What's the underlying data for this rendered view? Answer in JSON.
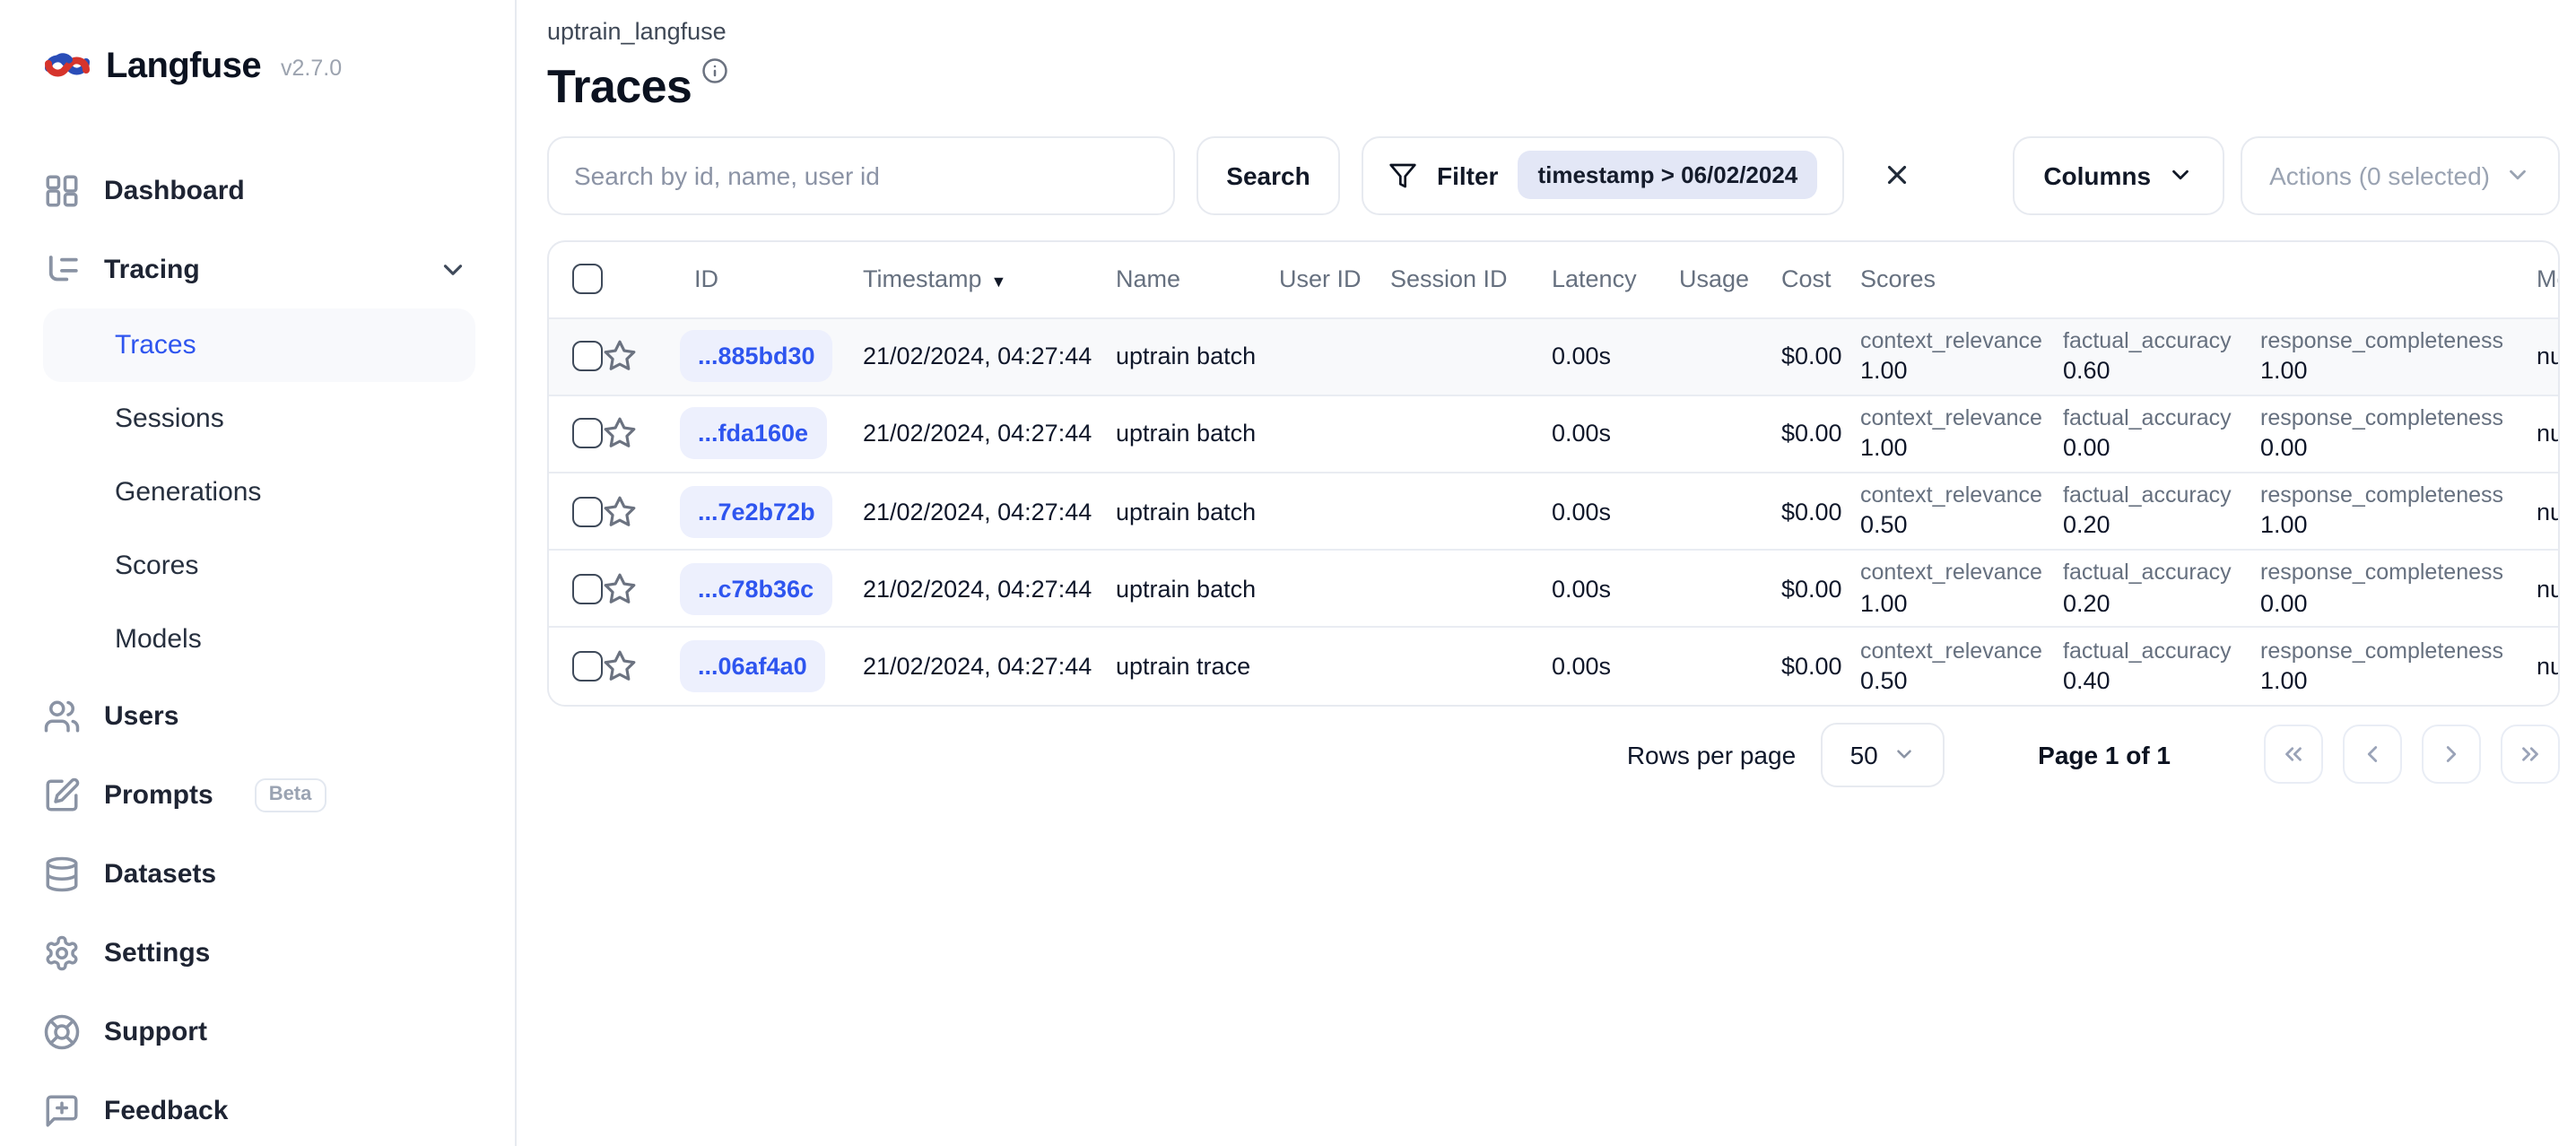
{
  "app": {
    "name": "Langfuse",
    "version": "v2.7.0"
  },
  "colors": {
    "accent_blue": "#2e55ef",
    "id_chip_bg": "#edf0fd",
    "filter_chip_bg": "#e3e7f6",
    "active_item_bg": "#f8f9fc"
  },
  "sidebar": {
    "dashboard": "Dashboard",
    "tracing": "Tracing",
    "tracing_children": {
      "traces": "Traces",
      "sessions": "Sessions",
      "generations": "Generations",
      "scores": "Scores",
      "models": "Models"
    },
    "users": "Users",
    "prompts": "Prompts",
    "prompts_badge": "Beta",
    "datasets": "Datasets",
    "settings": "Settings",
    "support": "Support",
    "feedback": "Feedback"
  },
  "header": {
    "project": "uptrain_langfuse",
    "title": "Traces"
  },
  "toolbar": {
    "search_placeholder": "Search by id, name, user id",
    "search_button": "Search",
    "filter_button": "Filter",
    "filter_chip": "timestamp > 06/02/2024",
    "columns_button": "Columns",
    "actions_button": "Actions (0 selected)"
  },
  "table": {
    "columns": {
      "id": "ID",
      "timestamp": "Timestamp",
      "sort_indicator": "▼",
      "name": "Name",
      "user_id": "User ID",
      "session_id": "Session ID",
      "latency": "Latency",
      "usage": "Usage",
      "cost": "Cost",
      "scores": "Scores",
      "metadata": "Metadata"
    },
    "rows": [
      {
        "id": "...885bd30",
        "timestamp": "21/02/2024, 04:27:44",
        "name": "uptrain batch",
        "latency": "0.00s",
        "cost": "$0.00",
        "metadata": "null",
        "scores": [
          {
            "label": "context_relevance",
            "value": "1.00"
          },
          {
            "label": "factual_accuracy",
            "value": "0.60"
          },
          {
            "label": "response_completeness",
            "value": "1.00"
          }
        ]
      },
      {
        "id": "...fda160e",
        "timestamp": "21/02/2024, 04:27:44",
        "name": "uptrain batch",
        "latency": "0.00s",
        "cost": "$0.00",
        "metadata": "null",
        "scores": [
          {
            "label": "context_relevance",
            "value": "1.00"
          },
          {
            "label": "factual_accuracy",
            "value": "0.00"
          },
          {
            "label": "response_completeness",
            "value": "0.00"
          }
        ]
      },
      {
        "id": "...7e2b72b",
        "timestamp": "21/02/2024, 04:27:44",
        "name": "uptrain batch",
        "latency": "0.00s",
        "cost": "$0.00",
        "metadata": "null",
        "scores": [
          {
            "label": "context_relevance",
            "value": "0.50"
          },
          {
            "label": "factual_accuracy",
            "value": "0.20"
          },
          {
            "label": "response_completeness",
            "value": "1.00"
          }
        ]
      },
      {
        "id": "...c78b36c",
        "timestamp": "21/02/2024, 04:27:44",
        "name": "uptrain batch",
        "latency": "0.00s",
        "cost": "$0.00",
        "metadata": "null",
        "scores": [
          {
            "label": "context_relevance",
            "value": "1.00"
          },
          {
            "label": "factual_accuracy",
            "value": "0.20"
          },
          {
            "label": "response_completeness",
            "value": "0.00"
          }
        ]
      },
      {
        "id": "...06af4a0",
        "timestamp": "21/02/2024, 04:27:44",
        "name": "uptrain trace",
        "latency": "0.00s",
        "cost": "$0.00",
        "metadata": "null",
        "scores": [
          {
            "label": "context_relevance",
            "value": "0.50"
          },
          {
            "label": "factual_accuracy",
            "value": "0.40"
          },
          {
            "label": "response_completeness",
            "value": "1.00"
          }
        ]
      }
    ]
  },
  "pagination": {
    "rows_per_page_label": "Rows per page",
    "rows_per_page_value": "50",
    "page_status": "Page 1 of 1"
  }
}
